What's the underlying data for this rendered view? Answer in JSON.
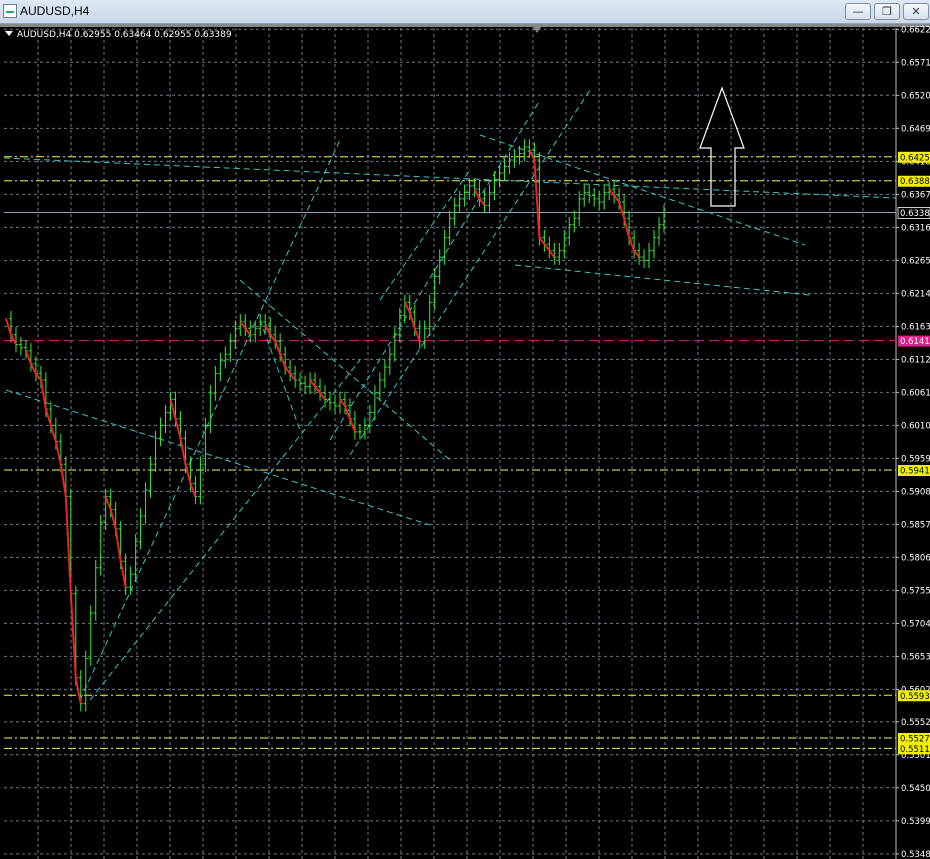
{
  "window": {
    "title": "AUDUSD,H4",
    "minimize_icon": "minimize-icon",
    "maximize_icon": "restore-icon",
    "close_icon": "close-icon"
  },
  "info_line": {
    "symbol": "AUDUSD,H4",
    "ohlc": "0.62955 0.63464 0.62955 0.63389"
  },
  "colors": {
    "background": "#000000",
    "grid": "#6e7a82",
    "candle": "#33ee33",
    "trend_red": "#ee2222",
    "channel": "#3ac4c4",
    "level_yellow": "#f0f060",
    "level_magenta": "#e0208a",
    "price_line": "#8fa3b8"
  },
  "chart_data": {
    "type": "line",
    "symbol": "AUDUSD",
    "timeframe": "H4",
    "y_axis_ticks": [
      "0.66220",
      "0.65710",
      "0.65200",
      "0.64690",
      "0.64180",
      "0.63670",
      "0.63160",
      "0.62650",
      "0.62140",
      "0.61630",
      "0.61120",
      "0.60610",
      "0.60100",
      "0.59590",
      "0.59080",
      "0.58570",
      "0.58060",
      "0.57550",
      "0.57040",
      "0.56530",
      "0.56020",
      "0.55520",
      "0.55010",
      "0.54500",
      "0.53990",
      "0.53480"
    ],
    "ylim": [
      0.534,
      0.6624
    ],
    "price_tags": [
      {
        "value": "0.64250",
        "color": "yellow"
      },
      {
        "value": "0.63880",
        "color": "yellow"
      },
      {
        "value": "0.63389",
        "color": "white"
      },
      {
        "value": "0.61410",
        "color": "magenta"
      },
      {
        "value": "0.59410",
        "color": "yellow"
      },
      {
        "value": "0.55930",
        "color": "yellow"
      },
      {
        "value": "0.55270",
        "color": "yellow"
      },
      {
        "value": "0.55110",
        "color": "yellow"
      }
    ],
    "horizontal_levels": [
      {
        "value": 0.6425,
        "color": "yellow"
      },
      {
        "value": 0.6388,
        "color": "yellow"
      },
      {
        "value": 0.6141,
        "color": "magenta"
      },
      {
        "value": 0.5941,
        "color": "yellow"
      },
      {
        "value": 0.5593,
        "color": "yellow"
      },
      {
        "value": 0.5527,
        "color": "yellow"
      },
      {
        "value": 0.5511,
        "color": "yellow"
      }
    ],
    "current_price": 0.63389,
    "series": [
      {
        "x": [
          0,
          5,
          10,
          15,
          20,
          25,
          30,
          35,
          40,
          45,
          50,
          55,
          60,
          65,
          70,
          75,
          80,
          85,
          90,
          95,
          100,
          105,
          110,
          115,
          120,
          125,
          130,
          135,
          140,
          145,
          150,
          155,
          160,
          165,
          170,
          175,
          180,
          185,
          190,
          195,
          200,
          205,
          210,
          215,
          220,
          225,
          230,
          235,
          240,
          245,
          250,
          255,
          260,
          265,
          270,
          275,
          280,
          285,
          290,
          295,
          300,
          305,
          310,
          315,
          320,
          325,
          330,
          335,
          340,
          345,
          350,
          355,
          360,
          365,
          370,
          375,
          380,
          385,
          390,
          395,
          400,
          405,
          410,
          415,
          420,
          425,
          430,
          435,
          440,
          445,
          450,
          455,
          460,
          465,
          470,
          475,
          480,
          485,
          490,
          495,
          500,
          505,
          510,
          515,
          520,
          525,
          530,
          535,
          540,
          545,
          550,
          555,
          560,
          565,
          570,
          575,
          580,
          585,
          590,
          595,
          600,
          605,
          610,
          615,
          620,
          625,
          630,
          635,
          640,
          645,
          650,
          655,
          660
        ],
        "values": [
          0.6175,
          0.615,
          0.6135,
          0.613,
          0.6125,
          0.6105,
          0.609,
          0.608,
          0.6035,
          0.601,
          0.5985,
          0.595,
          0.59,
          0.575,
          0.562,
          0.558,
          0.565,
          0.572,
          0.579,
          0.586,
          0.59,
          0.588,
          0.585,
          0.58,
          0.576,
          0.578,
          0.583,
          0.587,
          0.591,
          0.595,
          0.599,
          0.601,
          0.603,
          0.605,
          0.602,
          0.599,
          0.595,
          0.592,
          0.59,
          0.595,
          0.601,
          0.606,
          0.609,
          0.611,
          0.612,
          0.614,
          0.616,
          0.617,
          0.616,
          0.615,
          0.616,
          0.617,
          0.6165,
          0.615,
          0.614,
          0.612,
          0.61,
          0.609,
          0.608,
          0.6075,
          0.607,
          0.608,
          0.607,
          0.606,
          0.605,
          0.6045,
          0.604,
          0.605,
          0.604,
          0.602,
          0.6,
          0.6,
          0.601,
          0.603,
          0.606,
          0.608,
          0.61,
          0.612,
          0.615,
          0.618,
          0.62,
          0.6185,
          0.616,
          0.614,
          0.616,
          0.62,
          0.624,
          0.627,
          0.63,
          0.633,
          0.635,
          0.636,
          0.637,
          0.638,
          0.6375,
          0.636,
          0.635,
          0.637,
          0.639,
          0.64,
          0.641,
          0.642,
          0.6425,
          0.643,
          0.644,
          0.6435,
          0.642,
          0.63,
          0.629,
          0.628,
          0.627,
          0.628,
          0.63,
          0.632,
          0.633,
          0.636,
          0.637,
          0.6365,
          0.636,
          0.6355,
          0.637,
          0.6375,
          0.6365,
          0.6355,
          0.633,
          0.63,
          0.628,
          0.627,
          0.6265,
          0.628,
          0.63,
          0.632,
          0.6339
        ]
      }
    ],
    "annotations": [
      {
        "type": "arrow",
        "direction": "up"
      },
      {
        "type": "trend_channels",
        "style": "dashed",
        "color": "cyan"
      }
    ],
    "grid": true
  }
}
